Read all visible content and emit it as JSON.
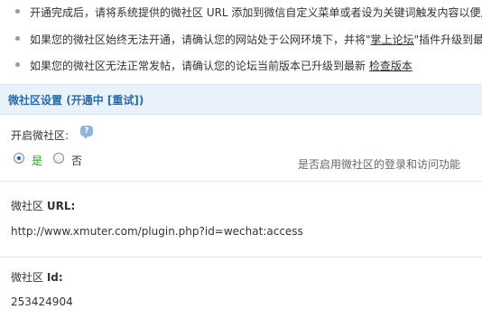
{
  "tips": [
    {
      "text": "开通完成后，请将系统提供的微社区 URL 添加到微信自定义菜单或者设为关键词触发内容以便用",
      "link": ""
    },
    {
      "text": "如果您的微社区始终无法开通，请确认您的网站处于公网环境下，并将\"",
      "link": "掌上论坛",
      "suffix": "\"插件升级到最"
    },
    {
      "text": "如果您的微社区无法正常发帖，请确认您的论坛当前版本已升级到最新",
      "link": "检查版本",
      "suffix": ""
    }
  ],
  "section": {
    "title": "微社区设置",
    "status_prefix": "(开通中",
    "retry_label": "[重试]",
    "status_suffix": ")"
  },
  "enable": {
    "label": "开启微社区:",
    "yes_label": "是",
    "no_label": "否",
    "selected": "yes",
    "hint": "是否启用微社区的登录和访问功能"
  },
  "url_field": {
    "label_prefix": "微社区 ",
    "label_bold": "URL:",
    "value": "http://www.xmuter.com/plugin.php?id=wechat:access"
  },
  "id_field": {
    "label_prefix": "微社区 ",
    "label_bold": "Id:",
    "value": "253424904"
  }
}
